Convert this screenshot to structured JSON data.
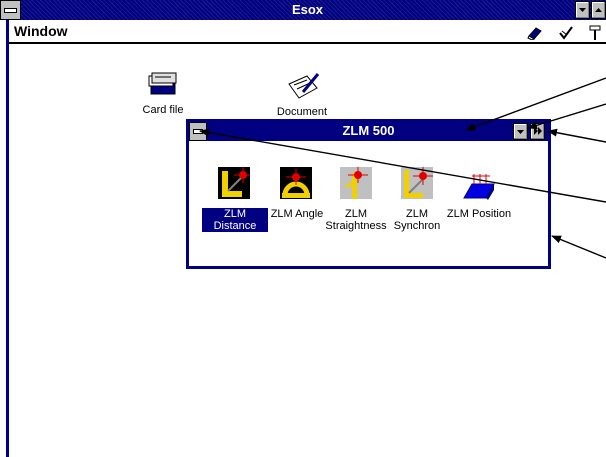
{
  "app": {
    "title": "Esox"
  },
  "menu": {
    "window_label": "Window"
  },
  "desktop_icons": [
    {
      "label": "Card file",
      "icon": "card-file-icon"
    },
    {
      "label": "Document",
      "icon": "document-icon"
    }
  ],
  "child_window": {
    "title": "ZLM 500",
    "icons": [
      {
        "label": "ZLM Distance",
        "icon": "zlm-distance-icon",
        "selected": true
      },
      {
        "label": "ZLM Angle",
        "icon": "zlm-angle-icon"
      },
      {
        "label_line1": "ZLM",
        "label_line2": "Straightness",
        "icon": "zlm-straightness-icon"
      },
      {
        "label_line1": "ZLM",
        "label_line2": "Synchron",
        "icon": "zlm-synchron-icon"
      },
      {
        "label": "ZLM Position",
        "icon": "zlm-position-icon"
      }
    ]
  },
  "colors": {
    "titlebar": "#000080",
    "selection": "#000080",
    "icon_red": "#e00000",
    "icon_yellow": "#f0d000"
  }
}
